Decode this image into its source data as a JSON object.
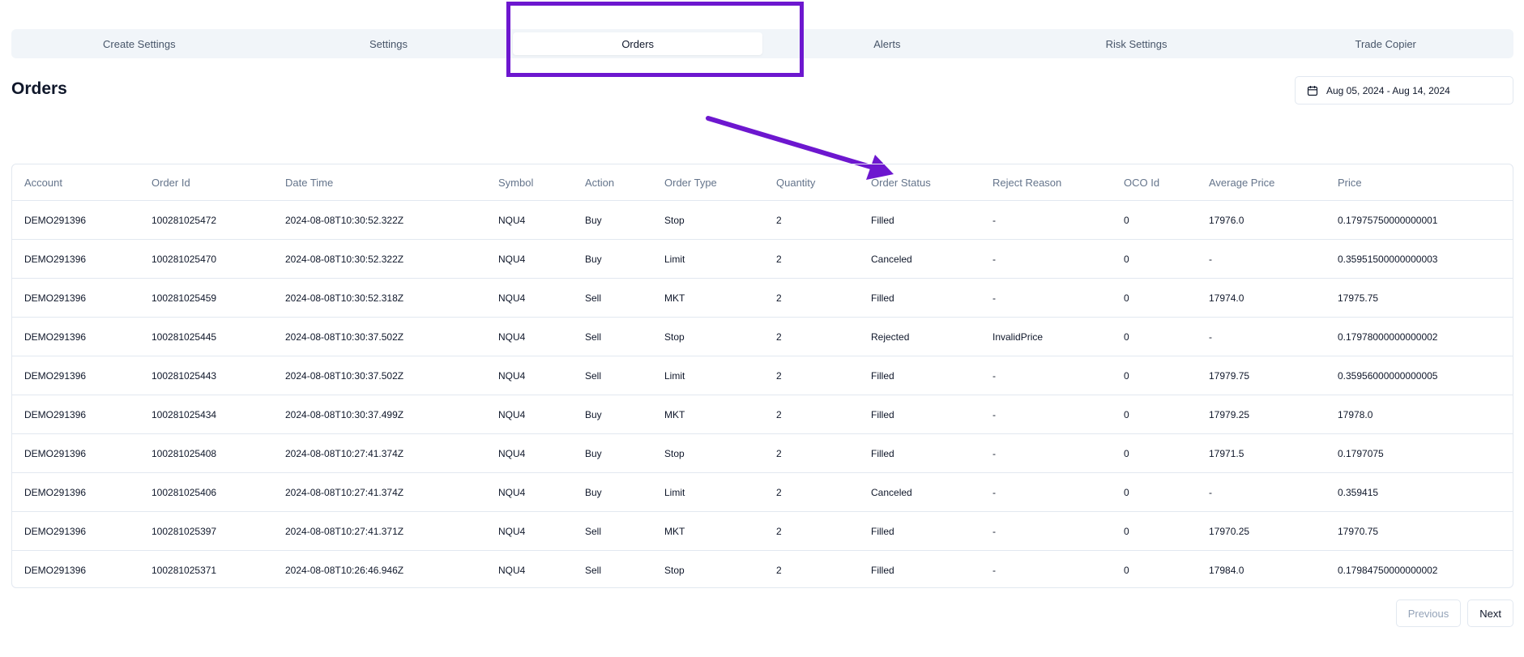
{
  "tabs": [
    {
      "label": "Create Settings"
    },
    {
      "label": "Settings"
    },
    {
      "label": "Orders"
    },
    {
      "label": "Alerts"
    },
    {
      "label": "Risk Settings"
    },
    {
      "label": "Trade Copier"
    }
  ],
  "active_tab": "Orders",
  "page_title": "Orders",
  "date_range": "Aug 05, 2024 - Aug 14, 2024",
  "annotation_color": "#6d17cf",
  "table": {
    "columns": [
      "Account",
      "Order Id",
      "Date Time",
      "Symbol",
      "Action",
      "Order Type",
      "Quantity",
      "Order Status",
      "Reject Reason",
      "OCO Id",
      "Average Price",
      "Price"
    ],
    "rows": [
      [
        "DEMO291396",
        "100281025472",
        "2024-08-08T10:30:52.322Z",
        "NQU4",
        "Buy",
        "Stop",
        "2",
        "Filled",
        "-",
        "0",
        "17976.0",
        "0.17975750000000001"
      ],
      [
        "DEMO291396",
        "100281025470",
        "2024-08-08T10:30:52.322Z",
        "NQU4",
        "Buy",
        "Limit",
        "2",
        "Canceled",
        "-",
        "0",
        "-",
        "0.35951500000000003"
      ],
      [
        "DEMO291396",
        "100281025459",
        "2024-08-08T10:30:52.318Z",
        "NQU4",
        "Sell",
        "MKT",
        "2",
        "Filled",
        "-",
        "0",
        "17974.0",
        "17975.75"
      ],
      [
        "DEMO291396",
        "100281025445",
        "2024-08-08T10:30:37.502Z",
        "NQU4",
        "Sell",
        "Stop",
        "2",
        "Rejected",
        "InvalidPrice",
        "0",
        "-",
        "0.17978000000000002"
      ],
      [
        "DEMO291396",
        "100281025443",
        "2024-08-08T10:30:37.502Z",
        "NQU4",
        "Sell",
        "Limit",
        "2",
        "Filled",
        "-",
        "0",
        "17979.75",
        "0.35956000000000005"
      ],
      [
        "DEMO291396",
        "100281025434",
        "2024-08-08T10:30:37.499Z",
        "NQU4",
        "Buy",
        "MKT",
        "2",
        "Filled",
        "-",
        "0",
        "17979.25",
        "17978.0"
      ],
      [
        "DEMO291396",
        "100281025408",
        "2024-08-08T10:27:41.374Z",
        "NQU4",
        "Buy",
        "Stop",
        "2",
        "Filled",
        "-",
        "0",
        "17971.5",
        "0.1797075"
      ],
      [
        "DEMO291396",
        "100281025406",
        "2024-08-08T10:27:41.374Z",
        "NQU4",
        "Buy",
        "Limit",
        "2",
        "Canceled",
        "-",
        "0",
        "-",
        "0.359415"
      ],
      [
        "DEMO291396",
        "100281025397",
        "2024-08-08T10:27:41.371Z",
        "NQU4",
        "Sell",
        "MKT",
        "2",
        "Filled",
        "-",
        "0",
        "17970.25",
        "17970.75"
      ],
      [
        "DEMO291396",
        "100281025371",
        "2024-08-08T10:26:46.946Z",
        "NQU4",
        "Sell",
        "Stop",
        "2",
        "Filled",
        "-",
        "0",
        "17984.0",
        "0.17984750000000002"
      ]
    ]
  },
  "pagination": {
    "previous_label": "Previous",
    "next_label": "Next"
  }
}
